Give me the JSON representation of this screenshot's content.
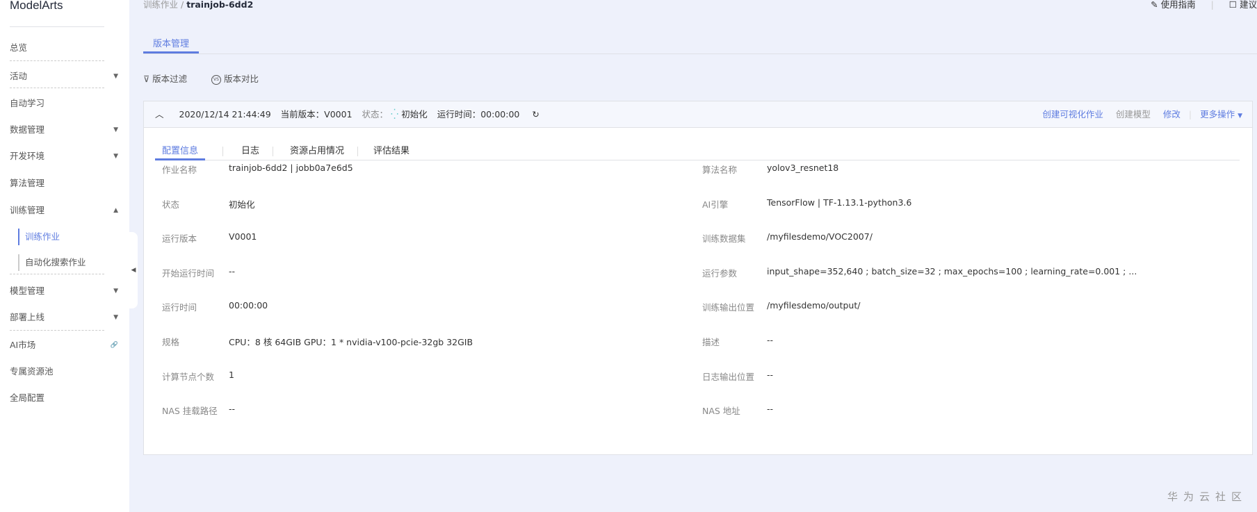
{
  "sidebar": {
    "logo": "ModelArts",
    "items": [
      {
        "label": "总览"
      },
      {
        "label": "活动",
        "arrow": "▼"
      },
      {
        "label": "自动学习"
      },
      {
        "label": "数据管理",
        "arrow": "▼"
      },
      {
        "label": "开发环境",
        "arrow": "▼"
      },
      {
        "label": "算法管理"
      },
      {
        "label": "训练管理",
        "arrow": "▲"
      },
      {
        "label": "训练作业"
      },
      {
        "label": "自动化搜索作业"
      },
      {
        "label": "模型管理",
        "arrow": "▼"
      },
      {
        "label": "部署上线",
        "arrow": "▼"
      },
      {
        "label": "AI市场",
        "arrow": "🔗"
      },
      {
        "label": "专属资源池"
      },
      {
        "label": "全局配置"
      }
    ]
  },
  "breadcrumb": {
    "parent": "训练作业",
    "sep": "/",
    "current": "trainjob-6dd2"
  },
  "toplinks": {
    "guide": "使用指南",
    "suggest": "建议"
  },
  "main_tab": "版本管理",
  "toolbar": {
    "filter": "版本过滤",
    "compare": "版本对比"
  },
  "version": {
    "time": "2020/12/14 21:44:49",
    "version_label": "当前版本：",
    "version": "V0001",
    "status_label": "状态：",
    "status": "初始化",
    "runtime_label": "运行时间：",
    "runtime": "00:00:00",
    "actions": {
      "visual": "创建可视化作业",
      "model": "创建模型",
      "edit": "修改",
      "more": "更多操作"
    }
  },
  "inner_tabs": [
    "配置信息",
    "日志",
    "资源占用情况",
    "评估结果"
  ],
  "left_fields": [
    {
      "label": "作业名称",
      "value": "trainjob-6dd2 | jobb0a7e6d5"
    },
    {
      "label": "状态",
      "value": "初始化"
    },
    {
      "label": "运行版本",
      "value": "V0001"
    },
    {
      "label": "开始运行时间",
      "value": "--"
    },
    {
      "label": "运行时间",
      "value": "00:00:00"
    },
    {
      "label": "规格",
      "value": "CPU：8 核 64GIB GPU：1 * nvidia-v100-pcie-32gb 32GIB"
    },
    {
      "label": "计算节点个数",
      "value": "1"
    },
    {
      "label": "NAS 挂载路径",
      "value": "--"
    }
  ],
  "right_fields": [
    {
      "label": "算法名称",
      "value": "yolov3_resnet18"
    },
    {
      "label": "AI引擎",
      "value": "TensorFlow | TF-1.13.1-python3.6"
    },
    {
      "label": "训练数据集",
      "value": "/myfilesdemo/VOC2007/"
    },
    {
      "label": "运行参数",
      "value": "input_shape=352,640 ; batch_size=32 ; max_epochs=100 ; learning_rate=0.001 ; ..."
    },
    {
      "label": "训练输出位置",
      "value": "/myfilesdemo/output/"
    },
    {
      "label": "描述",
      "value": "--"
    },
    {
      "label": "日志输出位置",
      "value": "--"
    },
    {
      "label": "NAS 地址",
      "value": "--"
    }
  ],
  "watermark": "华为云社区"
}
